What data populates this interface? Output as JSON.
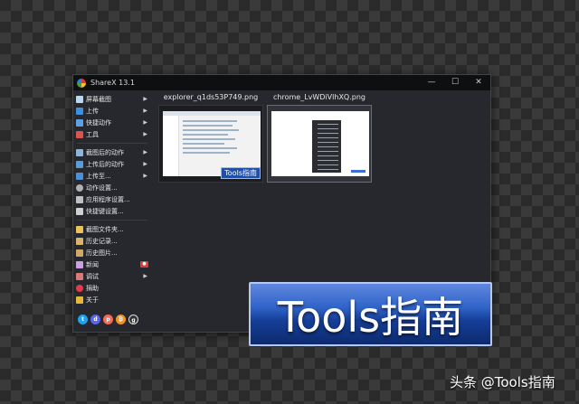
{
  "window": {
    "title": "ShareX 13.1",
    "controls": [
      "—",
      "☐",
      "✕"
    ]
  },
  "sidebar": {
    "items": [
      {
        "label": "屏幕截图",
        "icon": "monitor-icon",
        "color": "#bcd7f0",
        "submenu": true
      },
      {
        "label": "上传",
        "icon": "upload-arrow-icon",
        "color": "#3d8fe0",
        "submenu": true
      },
      {
        "label": "快捷动作",
        "icon": "grid-icon",
        "color": "#5aa0e6",
        "submenu": true
      },
      {
        "label": "工具",
        "icon": "toolbox-icon",
        "color": "#d9534f",
        "submenu": true
      },
      {
        "label": "截图后的动作",
        "icon": "image-icon",
        "color": "#8fb3d9",
        "submenu": true
      },
      {
        "label": "上传后的动作",
        "icon": "cloud-icon",
        "color": "#5b9bd5",
        "submenu": true
      },
      {
        "label": "上传至...",
        "icon": "folder-up-icon",
        "color": "#4a90d9",
        "submenu": true
      },
      {
        "label": "动作设置...",
        "icon": "gear-icon",
        "color": "#b0b0b0",
        "submenu": false
      },
      {
        "label": "应用程序设置...",
        "icon": "wrench-icon",
        "color": "#c0c0c0",
        "submenu": false
      },
      {
        "label": "快捷键设置...",
        "icon": "keyboard-icon",
        "color": "#d0d0d0",
        "submenu": false
      },
      {
        "label": "截图文件夹...",
        "icon": "folder-icon",
        "color": "#e8c35a",
        "submenu": false
      },
      {
        "label": "历史记录...",
        "icon": "history-icon",
        "color": "#d9b36a",
        "submenu": false
      },
      {
        "label": "历史图片...",
        "icon": "image-history-icon",
        "color": "#cfa86a",
        "submenu": false
      },
      {
        "label": "新闻",
        "icon": "news-icon",
        "color": "#c9a0e0",
        "submenu": false
      },
      {
        "label": "调试",
        "icon": "bug-icon",
        "color": "#d87a7a",
        "submenu": true
      },
      {
        "label": "捐助",
        "icon": "heart-icon",
        "color": "#e53950",
        "submenu": false
      },
      {
        "label": "关于",
        "icon": "crown-icon",
        "color": "#e5b83a",
        "submenu": false
      }
    ],
    "socials": [
      {
        "icon": "twitter-icon",
        "color": "#1da1f2"
      },
      {
        "icon": "discord-icon",
        "color": "#5865f2"
      },
      {
        "icon": "patreon-icon",
        "color": "#f96854"
      },
      {
        "icon": "bitcoin-icon",
        "color": "#f7931a"
      },
      {
        "icon": "github-icon",
        "color": "#333333"
      }
    ]
  },
  "thumbnails": [
    {
      "filename": "explorer_q1ds53P749.png",
      "watermark": "Tools指南"
    },
    {
      "filename": "chrome_LvWDiVlhXQ.png"
    }
  ],
  "overlay": {
    "watermark_text": "Tools指南",
    "credit": "头条 @Tools指南"
  }
}
